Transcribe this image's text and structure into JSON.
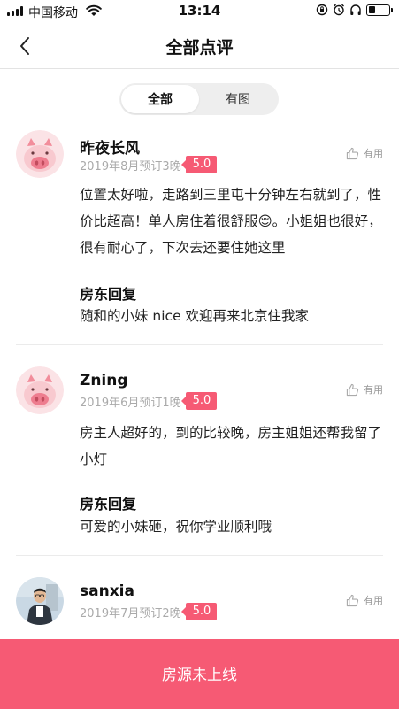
{
  "status_bar": {
    "carrier": "中国移动",
    "time": "13:14",
    "battery_level": 0.35
  },
  "nav": {
    "title": "全部点评",
    "back_icon": "chevron-left-icon"
  },
  "filter_tabs": [
    {
      "label": "全部",
      "active": true
    },
    {
      "label": "有图",
      "active": false
    }
  ],
  "reviews": [
    {
      "name": "昨夜长风",
      "date": "2019年8月预订3晚",
      "rating": "5.0",
      "useful_label": "有用",
      "text": "位置太好啦，走路到三里屯十分钟左右就到了，性价比超高！单人房住着很舒服😌。小姐姐也很好，很有耐心了，下次去还要住她这里",
      "host_reply_label": "房东回复",
      "host_reply": "随和的小妹 nice 欢迎再来北京住我家",
      "avatar": "pink-pig-avatar"
    },
    {
      "name": "Zning",
      "date": "2019年6月预订1晚",
      "rating": "5.0",
      "useful_label": "有用",
      "text": "房主人超好的，到的比较晚，房主姐姐还帮我留了小灯",
      "host_reply_label": "房东回复",
      "host_reply": "可爱的小妹砸，祝你学业顺利哦",
      "avatar": "pink-pig-avatar"
    },
    {
      "name": "sanxia",
      "date": "2019年7月预订2晚",
      "rating": "5.0",
      "useful_label": "有用",
      "text": "",
      "avatar": "user-photo-avatar"
    }
  ],
  "bottom_bar": {
    "label": "房源未上线",
    "color": "#f65a74"
  },
  "colors": {
    "accent": "#f65a74",
    "pig_pink": "#f8c9cf"
  }
}
